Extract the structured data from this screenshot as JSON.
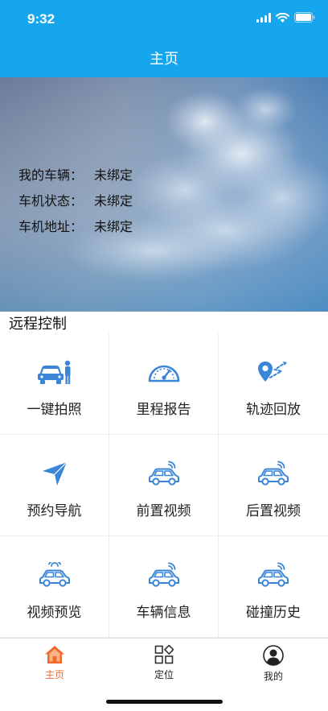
{
  "status_bar": {
    "time": "9:32"
  },
  "nav": {
    "title": "主页"
  },
  "vehicle_info": [
    {
      "label": "我的车辆：",
      "value": "未绑定"
    },
    {
      "label": "车机状态：",
      "value": "未绑定"
    },
    {
      "label": "车机地址：",
      "value": "未绑定"
    }
  ],
  "section": {
    "title": "远程控制"
  },
  "grid": [
    {
      "label": "一键拍照",
      "icon": "car-person-icon"
    },
    {
      "label": "里程报告",
      "icon": "speedometer-icon"
    },
    {
      "label": "轨迹回放",
      "icon": "route-pin-icon"
    },
    {
      "label": "预约导航",
      "icon": "navigation-arrow-icon"
    },
    {
      "label": "前置视频",
      "icon": "car-signal-icon"
    },
    {
      "label": "后置视频",
      "icon": "car-signal-icon"
    },
    {
      "label": "视频预览",
      "icon": "car-signal-icon"
    },
    {
      "label": "车辆信息",
      "icon": "car-signal-icon"
    },
    {
      "label": "碰撞历史",
      "icon": "car-signal-icon"
    }
  ],
  "tabbar": [
    {
      "label": "主页",
      "icon": "home-icon",
      "active": true
    },
    {
      "label": "定位",
      "icon": "apps-grid-icon",
      "active": false
    },
    {
      "label": "我的",
      "icon": "user-icon",
      "active": false
    }
  ],
  "colors": {
    "primary": "#15a6ee",
    "icon_blue": "#3a85d8",
    "tab_active": "#f06a2a"
  }
}
